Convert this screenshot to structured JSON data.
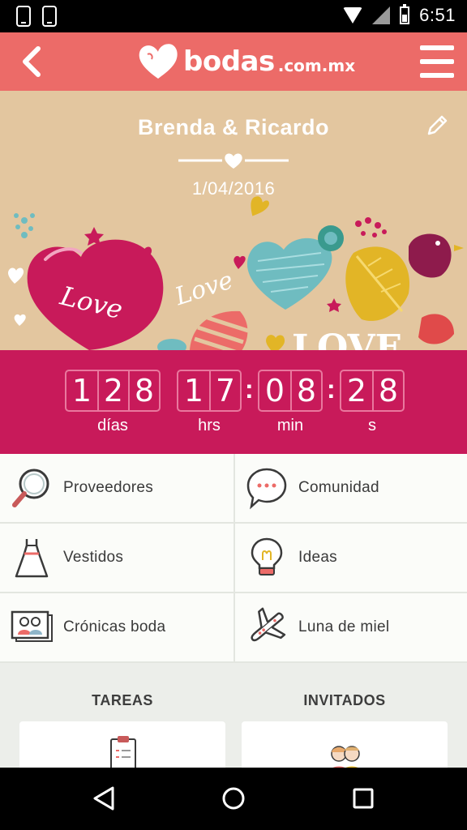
{
  "status_bar": {
    "time": "6:51",
    "left_icons": [
      "phone-icon",
      "phone-icon"
    ],
    "right_icons": [
      "wifi-icon",
      "signal-icon",
      "battery-icon"
    ]
  },
  "header": {
    "brand": "bodas",
    "brand_suffix": ".com.mx",
    "back_icon": "back-arrow-icon",
    "menu_icon": "hamburger-menu-icon"
  },
  "hero": {
    "couple_names": "Brenda & Ricardo",
    "wedding_date": "1/04/2016",
    "art_text": [
      "Love",
      "Love",
      "LOVE"
    ],
    "colors": {
      "background": "#e3c69f",
      "heart": "#c81a5a",
      "teal": "#6fbcc0",
      "gold": "#e2b526"
    }
  },
  "countdown": {
    "days": [
      "1",
      "2",
      "8"
    ],
    "hours": [
      "1",
      "7"
    ],
    "minutes": [
      "0",
      "8"
    ],
    "seconds": [
      "2",
      "8"
    ],
    "labels": {
      "days": "días",
      "hours": "hrs",
      "minutes": "min",
      "seconds": "s"
    }
  },
  "menu": {
    "items": [
      {
        "label": "Proveedores",
        "icon": "magnifier-icon"
      },
      {
        "label": "Comunidad",
        "icon": "chat-bubble-icon"
      },
      {
        "label": "Vestidos",
        "icon": "dress-icon"
      },
      {
        "label": "Ideas",
        "icon": "lightbulb-icon"
      },
      {
        "label": "Crónicas boda",
        "icon": "photos-icon"
      },
      {
        "label": "Luna de miel",
        "icon": "airplane-icon"
      }
    ]
  },
  "cards": {
    "tasks_title": "TAREAS",
    "guests_title": "INVITADOS"
  },
  "nav": {
    "back": "nav-back-icon",
    "home": "nav-home-icon",
    "recents": "nav-recents-icon"
  },
  "theme": {
    "header": "#ec6b68",
    "countdown": "#c81a5a",
    "accent": "#e9789e"
  }
}
